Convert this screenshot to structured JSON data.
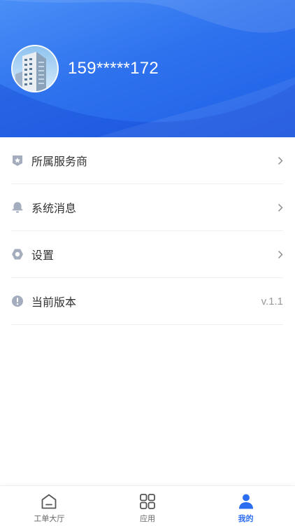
{
  "profile": {
    "phone": "159*****172",
    "avatar_icon": "building-photo-avatar"
  },
  "menu": {
    "items": [
      {
        "label": "所属服务商",
        "icon": "shield-star-icon",
        "value": "",
        "arrow": true
      },
      {
        "label": "系统消息",
        "icon": "bell-icon",
        "value": "",
        "arrow": true
      },
      {
        "label": "设置",
        "icon": "hexagon-gear-icon",
        "value": "",
        "arrow": true
      },
      {
        "label": "当前版本",
        "icon": "exclamation-circle-icon",
        "value": "v.1.1",
        "arrow": false
      }
    ]
  },
  "tabbar": {
    "tabs": [
      {
        "label": "工单大厅",
        "icon": "home-icon",
        "active": false
      },
      {
        "label": "应用",
        "icon": "grid-apps-icon",
        "active": false
      },
      {
        "label": "我的",
        "icon": "user-icon",
        "active": true
      }
    ]
  },
  "colors": {
    "accent": "#2d6ef0",
    "header_start": "#4a8ff7",
    "header_end": "#1e5fe6",
    "icon_gray": "#a4adbd"
  }
}
